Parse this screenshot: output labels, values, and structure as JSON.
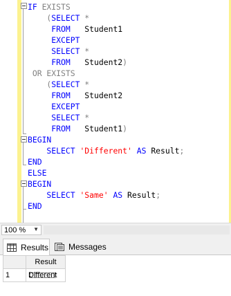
{
  "editor": {
    "lines": [
      [
        {
          "t": "IF EXISTS",
          "c": "kw-gray-split"
        }
      ],
      [
        {
          "t": "    (",
          "c": "gray"
        },
        {
          "t": "SELECT",
          "c": "kw"
        },
        {
          "t": " *",
          "c": "gray"
        }
      ],
      [
        {
          "t": "     FROM",
          "c": "kw"
        },
        {
          "t": "   Student1",
          "c": "id"
        }
      ],
      [
        {
          "t": "     EXCEPT",
          "c": "kw"
        }
      ],
      [
        {
          "t": "     SELECT",
          "c": "kw"
        },
        {
          "t": " *",
          "c": "gray"
        }
      ],
      [
        {
          "t": "     FROM",
          "c": "kw"
        },
        {
          "t": "   Student2",
          "c": "id"
        },
        {
          "t": ")",
          "c": "gray"
        }
      ],
      [
        {
          "t": " OR EXISTS",
          "c": "gray"
        }
      ],
      [
        {
          "t": "    (",
          "c": "gray"
        },
        {
          "t": "SELECT",
          "c": "kw"
        },
        {
          "t": " *",
          "c": "gray"
        }
      ],
      [
        {
          "t": "     FROM",
          "c": "kw"
        },
        {
          "t": "   Student2",
          "c": "id"
        }
      ],
      [
        {
          "t": "     EXCEPT",
          "c": "kw"
        }
      ],
      [
        {
          "t": "     SELECT",
          "c": "kw"
        },
        {
          "t": " *",
          "c": "gray"
        }
      ],
      [
        {
          "t": "     FROM",
          "c": "kw"
        },
        {
          "t": "   Student1",
          "c": "id"
        },
        {
          "t": ")",
          "c": "gray"
        }
      ],
      [
        {
          "t": "BEGIN",
          "c": "kw"
        }
      ],
      [
        {
          "t": "    SELECT ",
          "c": "kw"
        },
        {
          "t": "'Different'",
          "c": "str"
        },
        {
          "t": " AS ",
          "c": "kw"
        },
        {
          "t": "Result",
          "c": "id"
        },
        {
          "t": ";",
          "c": "gray"
        }
      ],
      [
        {
          "t": "END",
          "c": "kw"
        }
      ],
      [
        {
          "t": "ELSE",
          "c": "kw"
        }
      ],
      [
        {
          "t": "BEGIN",
          "c": "kw"
        }
      ],
      [
        {
          "t": "    SELECT ",
          "c": "kw"
        },
        {
          "t": "'Same'",
          "c": "str"
        },
        {
          "t": " AS ",
          "c": "kw"
        },
        {
          "t": "Result",
          "c": "id"
        },
        {
          "t": ";",
          "c": "gray"
        }
      ],
      [
        {
          "t": "END",
          "c": "kw"
        }
      ]
    ]
  },
  "zoom": {
    "value": "100 %"
  },
  "tabs": {
    "results": "Results",
    "messages": "Messages"
  },
  "grid": {
    "header": "Result",
    "rows": [
      {
        "num": "1",
        "value": "Different"
      }
    ]
  },
  "colors": {
    "keyword": "#0000ff",
    "gray": "#808080",
    "string": "#ff0000",
    "gutter": "#fcf28f"
  }
}
